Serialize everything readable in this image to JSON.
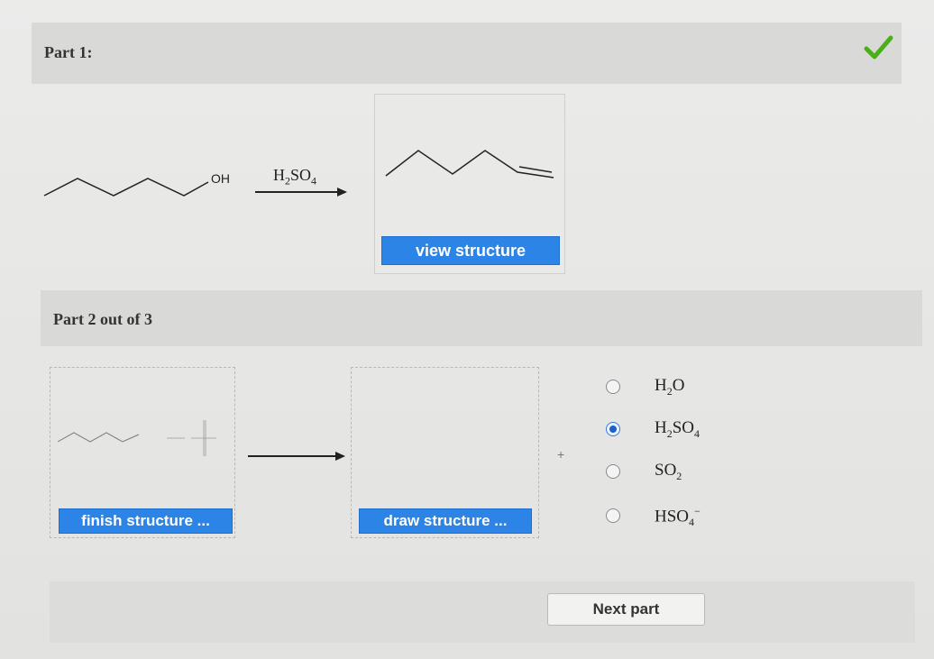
{
  "part1": {
    "title": "Part 1:",
    "status_icon": "checkmark-icon",
    "status_color": "#4caf1a",
    "reactant_label": "OH",
    "reagent": {
      "main": "H",
      "sub1": "2",
      "mid": "SO",
      "sub2": "4"
    },
    "view_button": "view structure"
  },
  "part2": {
    "title": "Part 2 out of 3",
    "finish_button": "finish structure ...",
    "draw_button": "draw structure ...",
    "plus": "+",
    "options": [
      {
        "main": "H",
        "sub": "2",
        "tail": "O",
        "sub2": "",
        "sup": "",
        "selected": false
      },
      {
        "main": "H",
        "sub": "2",
        "tail": "SO",
        "sub2": "4",
        "sup": "",
        "selected": true
      },
      {
        "main": "SO",
        "sub": "2",
        "tail": "",
        "sub2": "",
        "sup": "",
        "selected": false
      },
      {
        "main": "HSO",
        "sub": "4",
        "tail": "",
        "sub2": "",
        "sup": "−",
        "selected": false
      }
    ]
  },
  "footer": {
    "next_button": "Next part"
  },
  "colors": {
    "accent_blue": "#2b84e6",
    "radio_selected": "#1e5fc4"
  }
}
